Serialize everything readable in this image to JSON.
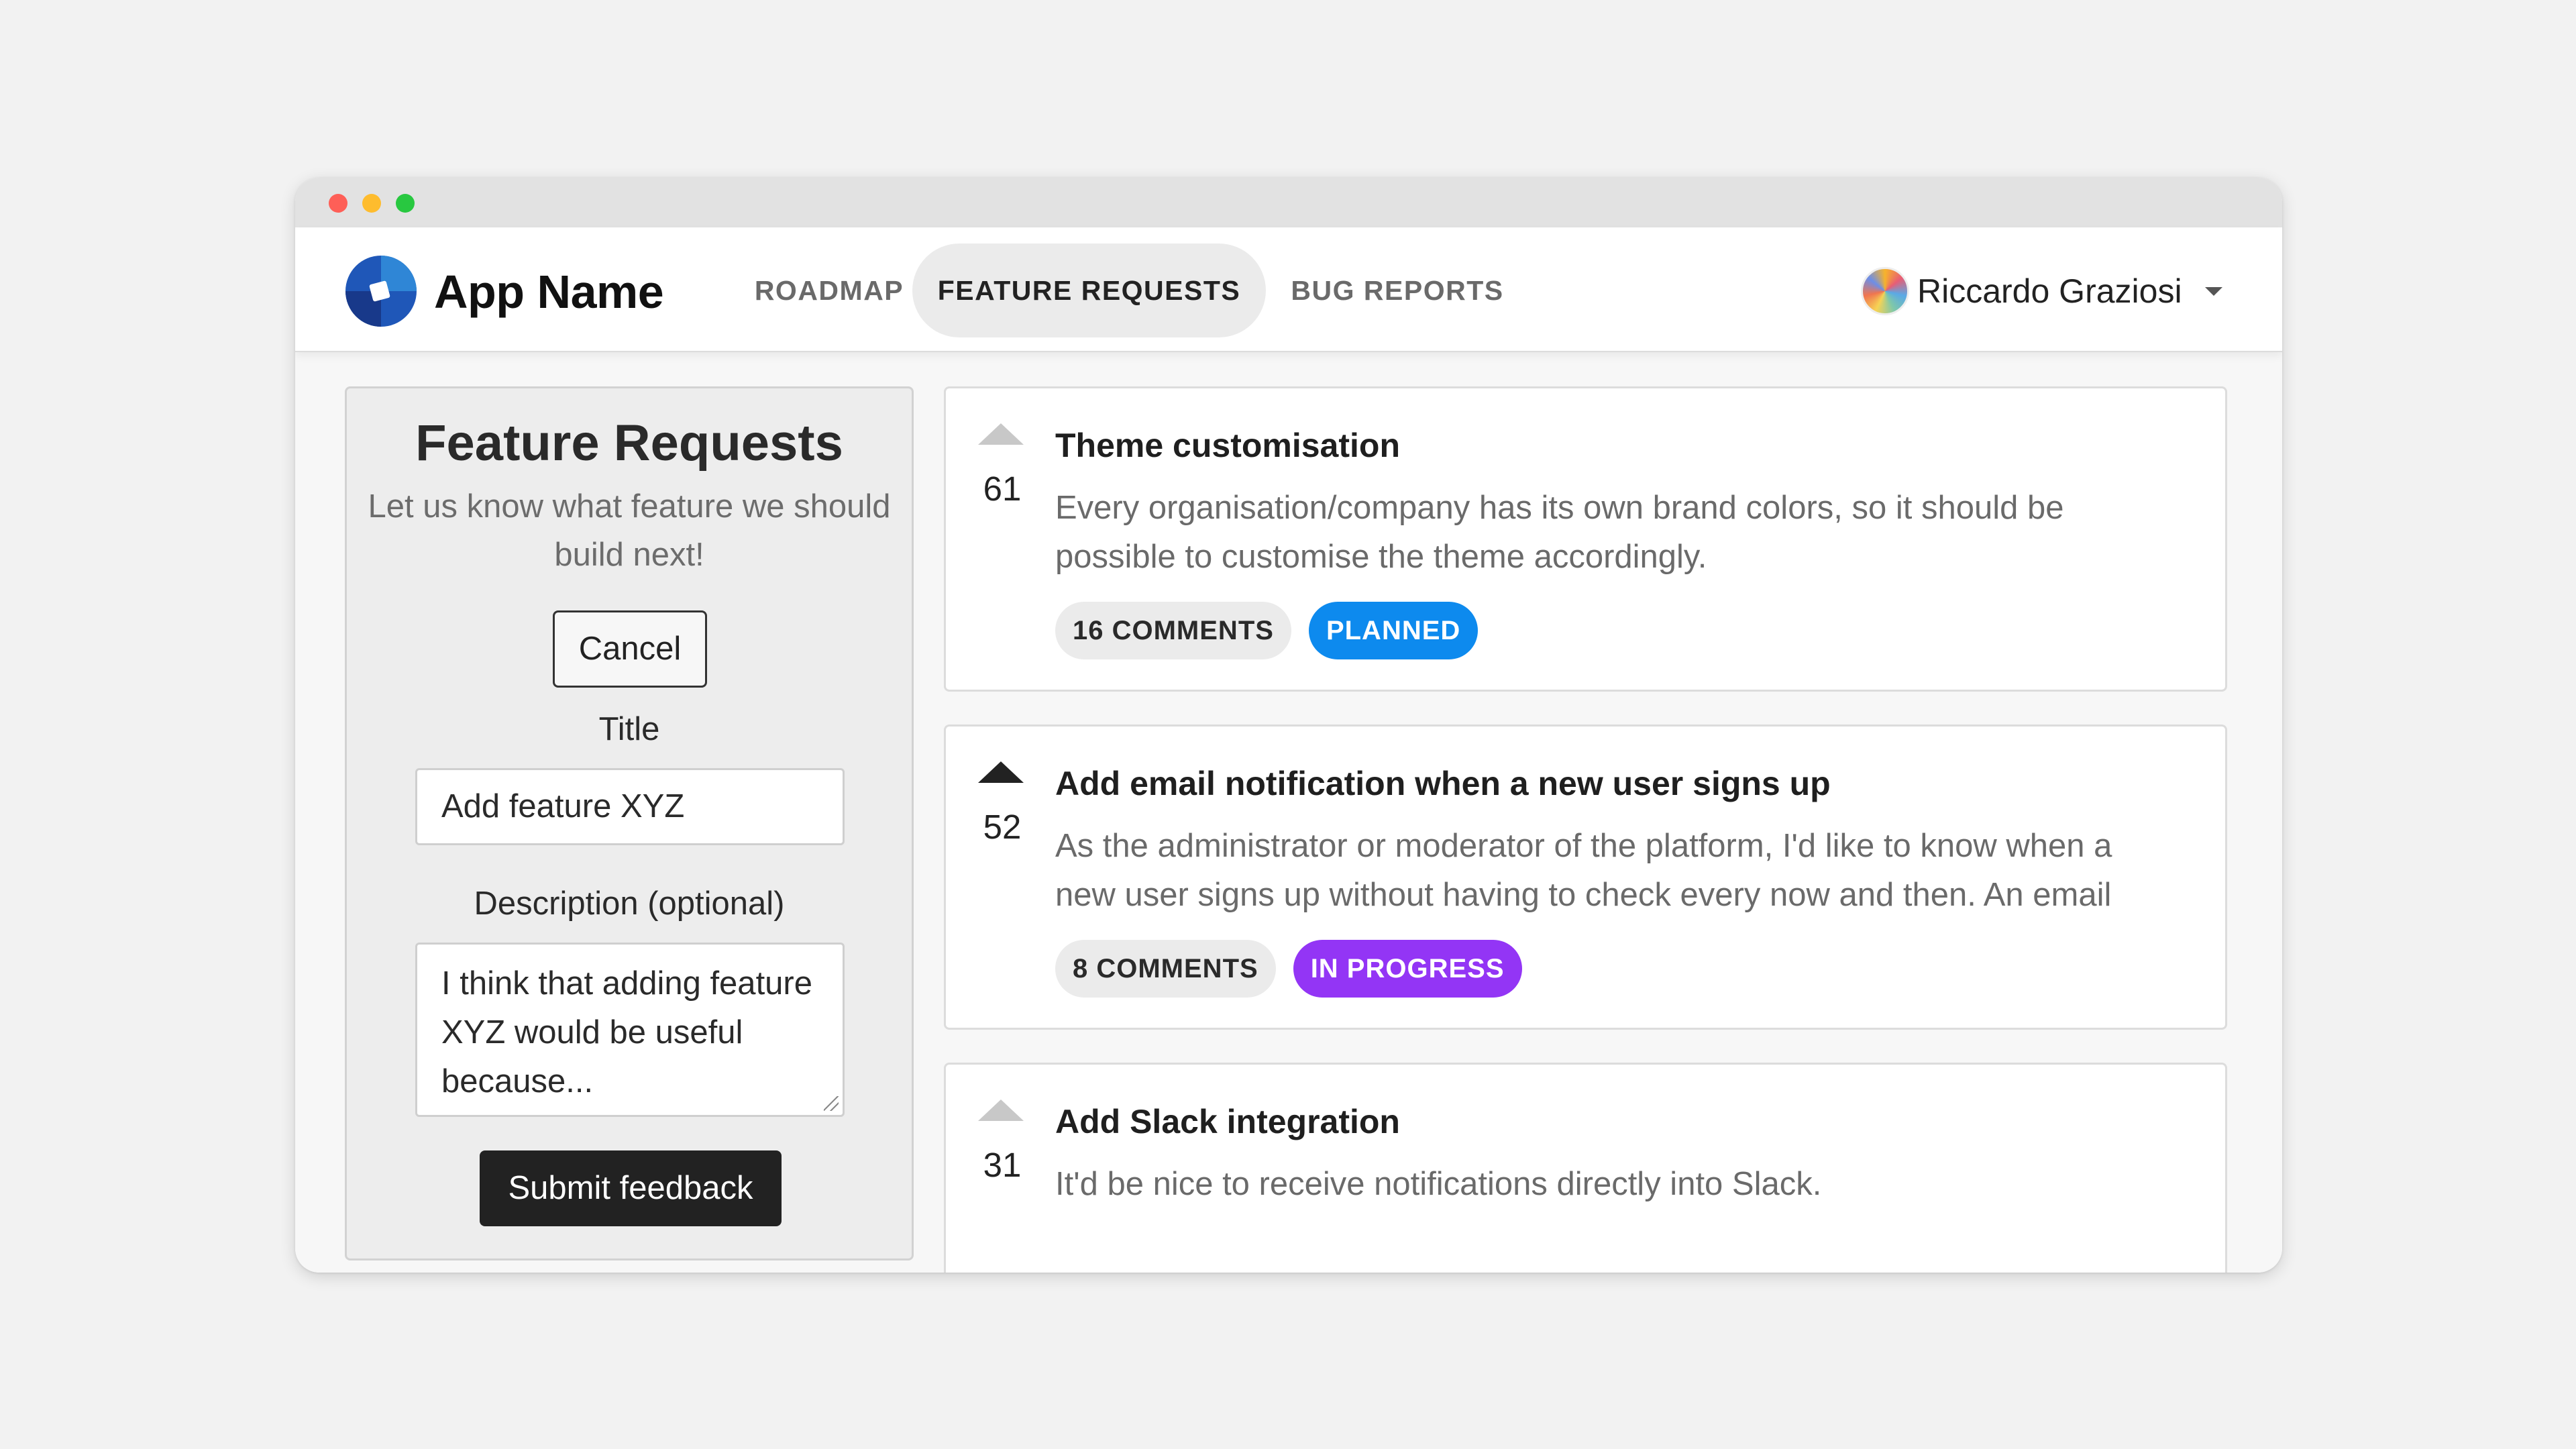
{
  "app": {
    "name": "App Name",
    "logo_icon": "app-logo-icon"
  },
  "nav": {
    "tabs": [
      {
        "label": "ROADMAP",
        "active": false
      },
      {
        "label": "FEATURE REQUESTS",
        "active": true
      },
      {
        "label": "BUG REPORTS",
        "active": false
      }
    ]
  },
  "user": {
    "name": "Riccardo Graziosi",
    "avatar_icon": "avatar-icon",
    "menu_icon": "caret-down-icon"
  },
  "sidebar": {
    "title": "Feature Requests",
    "subtitle": "Let us know what feature we should build next!",
    "cancel_label": "Cancel",
    "title_label": "Title",
    "title_value": "Add feature XYZ",
    "description_label": "Description (optional)",
    "description_value": "I think that adding feature XYZ would be useful because...",
    "submit_label": "Submit feedback"
  },
  "posts": [
    {
      "votes": "61",
      "upvoted": false,
      "title": "Theme customisation",
      "description": "Every organisation/company has its own brand colors, so it should be possible to customise the theme accordingly.",
      "comments": "16 COMMENTS",
      "status": "PLANNED"
    },
    {
      "votes": "52",
      "upvoted": true,
      "title": "Add email notification when a new user signs up",
      "description": "As the administrator or moderator of the platform, I'd like to know when a new user signs up without having to check every now and then. An email",
      "comments": "8 COMMENTS",
      "status": "IN PROGRESS"
    },
    {
      "votes": "31",
      "upvoted": false,
      "title": "Add Slack integration",
      "description": "It'd be nice to receive notifications directly into Slack.",
      "comments": "",
      "status": ""
    }
  ],
  "colors": {
    "planned": "#0d8aee",
    "in_progress": "#9335f5",
    "accent_logo": "#1f57b8"
  }
}
